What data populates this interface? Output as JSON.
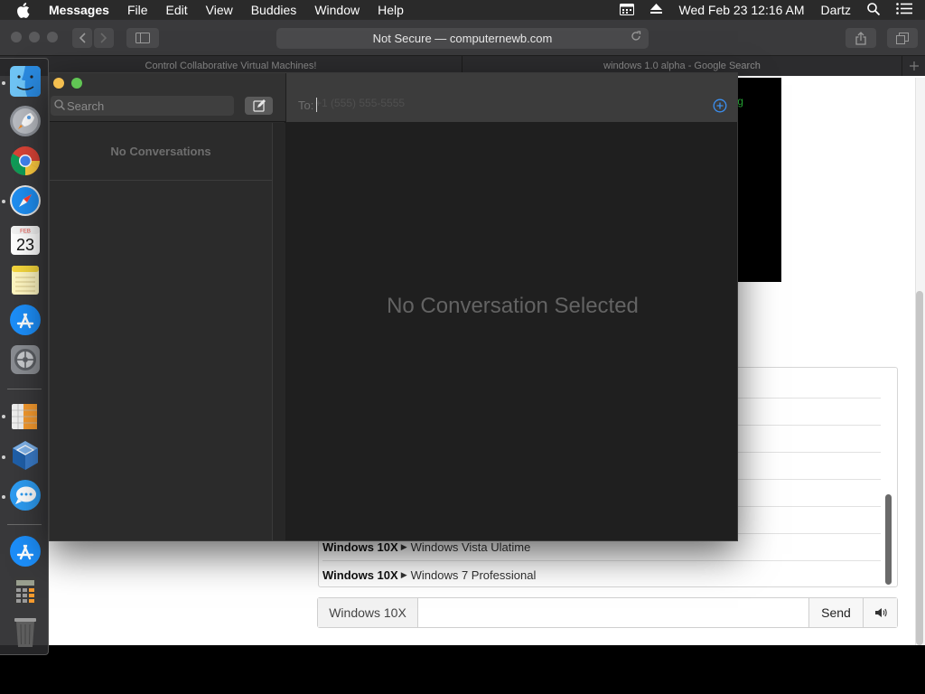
{
  "menubar": {
    "app_name": "Messages",
    "menus": [
      "File",
      "Edit",
      "View",
      "Buddies",
      "Window",
      "Help"
    ],
    "datetime": "Wed Feb 23  12:16 AM",
    "user": "Dartz"
  },
  "safari": {
    "url_text": "Not Secure — computernewb.com",
    "tabs": [
      "Control Collaborative Virtual Machines!",
      "windows 1.0 alpha - Google Search"
    ]
  },
  "web": {
    "terminal_fragment": "g",
    "options": [
      {
        "prefix": "",
        "name": ""
      },
      {
        "prefix": "",
        "name": ""
      },
      {
        "prefix": "",
        "name": ""
      },
      {
        "prefix": "",
        "name": ""
      },
      {
        "prefix": "",
        "name": ""
      },
      {
        "prefix": "",
        "name": ""
      },
      {
        "prefix": "Windows 10X",
        "name": "Windows Vista Ulatime"
      },
      {
        "prefix": "Windows 10X",
        "name": "Windows 7 Professional"
      }
    ],
    "input_prefix": "Windows 10X",
    "input_value": "",
    "send_label": "Send"
  },
  "dock": {
    "calendar_month": "FEB",
    "calendar_day": "23"
  },
  "messages": {
    "search_placeholder": "Search",
    "no_conversations": "No Conversations",
    "to_label": "To:",
    "to_placeholder": "+1 (555) 555-5555",
    "no_selection": "No Conversation Selected"
  }
}
